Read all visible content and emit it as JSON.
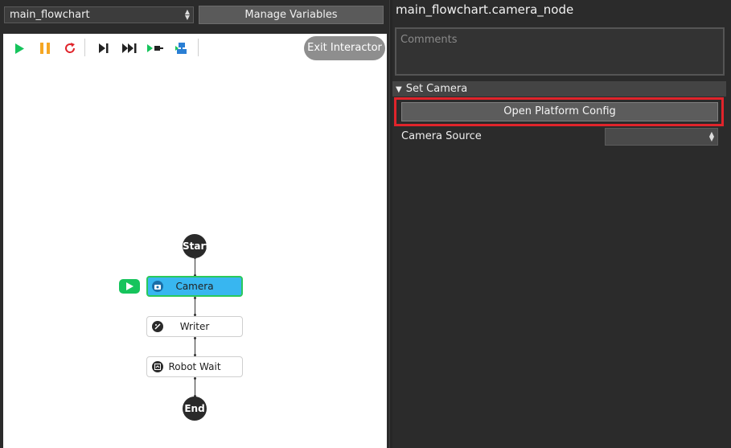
{
  "flowchart_select": {
    "value": "main_flowchart"
  },
  "toolbar": {
    "manage_variables": "Manage Variables",
    "exit_interactor": "Exit Interactor"
  },
  "flow": {
    "start": "Start",
    "end": "End",
    "nodes": [
      {
        "label": "Camera",
        "icon": "camera-icon",
        "active": true
      },
      {
        "label": "Writer",
        "icon": "writer-icon",
        "active": false
      },
      {
        "label": "Robot Wait",
        "icon": "robot-wait-icon",
        "active": false
      }
    ]
  },
  "panel": {
    "title": "main_flowchart.camera_node",
    "comments_placeholder": "Comments",
    "section": "Set Camera",
    "open_config": "Open Platform Config",
    "camera_source_label": "Camera Source",
    "camera_source_value": ""
  },
  "colors": {
    "play": "#16c45c",
    "pause": "#f5a623",
    "restart": "#e0242b",
    "active_node": "#38b6f0",
    "active_border": "#2bc95b",
    "highlight": "#e0242b"
  }
}
